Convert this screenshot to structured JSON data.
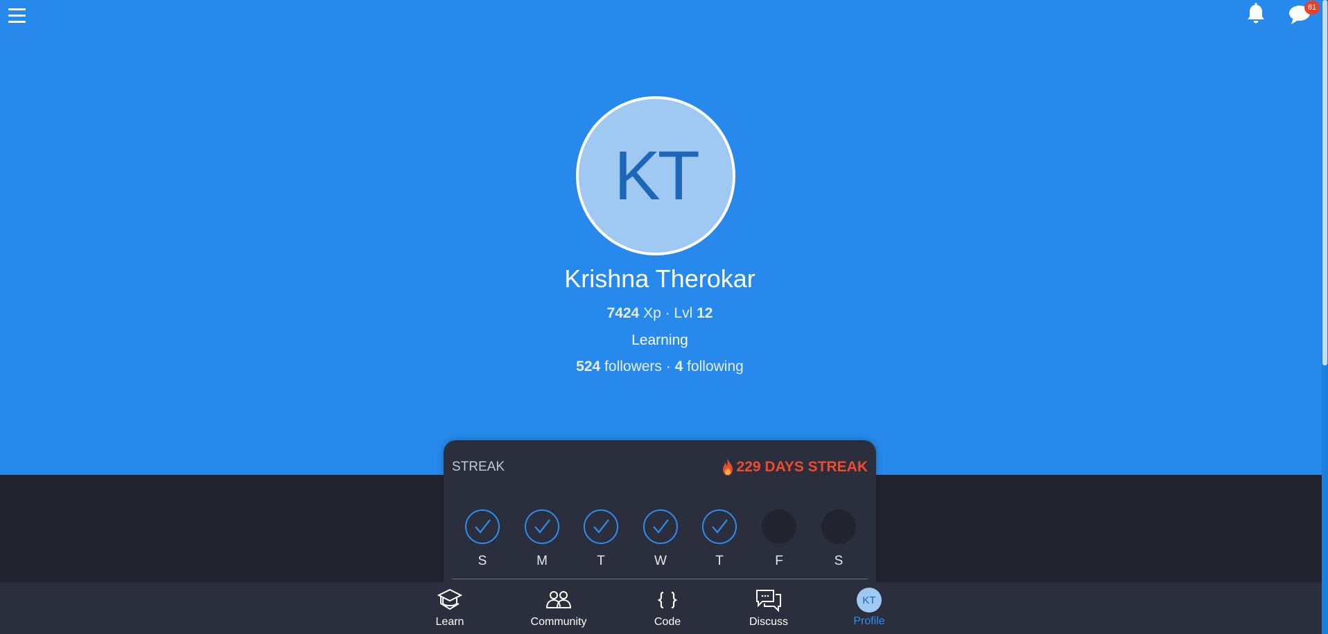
{
  "header": {
    "menu_icon": "hamburger-menu-icon",
    "notifications_icon": "bell-icon",
    "messages_icon": "chat-bubble-icon",
    "messages_badge": "81"
  },
  "profile": {
    "initials": "KT",
    "name": "Krishna Therokar",
    "xp": "7424",
    "xp_unit": " Xp · Lvl ",
    "level": "12",
    "status": "Learning",
    "followers": "524",
    "followers_label": " followers · ",
    "following": "4",
    "following_label": " following"
  },
  "streak": {
    "title": "STREAK",
    "count_text": "229 DAYS STREAK",
    "days": [
      {
        "letter": "S",
        "done": true
      },
      {
        "letter": "M",
        "done": true
      },
      {
        "letter": "T",
        "done": true
      },
      {
        "letter": "W",
        "done": true
      },
      {
        "letter": "T",
        "done": true
      },
      {
        "letter": "F",
        "done": false
      },
      {
        "letter": "S",
        "done": false
      }
    ]
  },
  "bottom_nav": {
    "items": [
      {
        "label": "Learn",
        "icon": "graduation-cap-icon"
      },
      {
        "label": "Community",
        "icon": "people-icon"
      },
      {
        "label": "Code",
        "icon": "code-braces-icon"
      },
      {
        "label": "Discuss",
        "icon": "discussion-icon"
      },
      {
        "label": "Profile",
        "icon": "profile-avatar",
        "initials": "KT",
        "active": true
      }
    ]
  },
  "colors": {
    "hero_background": "#2689eb",
    "dark_background": "#21232e",
    "card_background": "#2b2e3c",
    "accent_blue": "#2e8ef0",
    "streak_red": "#f04b2e",
    "badge_red": "#e8412a"
  }
}
